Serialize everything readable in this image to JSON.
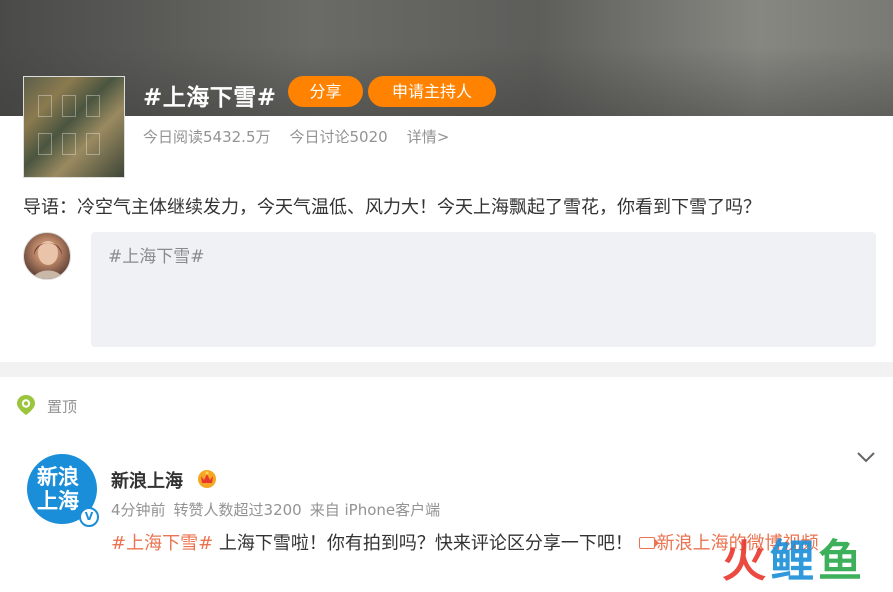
{
  "topic": {
    "title": "#上海下雪#",
    "share_label": "分享",
    "apply_host_label": "申请主持人",
    "reads": "今日阅读5432.5万",
    "discussions": "今日讨论5020",
    "details_label": "详情>",
    "intro": "导语：冷空气主体继续发力，今天气温低、风力大！今天上海飘起了雪花，你看到下雪了吗？"
  },
  "composer": {
    "text": "#上海下雪#"
  },
  "pinned": {
    "label": "置顶"
  },
  "post": {
    "author": "新浪上海",
    "avatar_line1": "新浪",
    "avatar_line2": "上海",
    "verified_mark": "V",
    "time": "4分钟前",
    "reposts_note": "转赞人数超过3200",
    "source": "来自 iPhone客户端",
    "hashtag": "#上海下雪#",
    "body": " 上海下雪啦！你有拍到吗？快来评论区分享一下吧！ ",
    "video_link": "新浪上海的微博视频"
  },
  "watermark": {
    "chars": [
      "火",
      "鲤",
      "鱼"
    ]
  },
  "colors": {
    "accent": "#ff8200",
    "link": "#eb7350",
    "muted": "#939393",
    "brand_blue": "#1a8ed8"
  },
  "icons": [
    "pin-icon",
    "chevron-down-icon",
    "crown-icon",
    "video-icon",
    "verified-icon"
  ]
}
